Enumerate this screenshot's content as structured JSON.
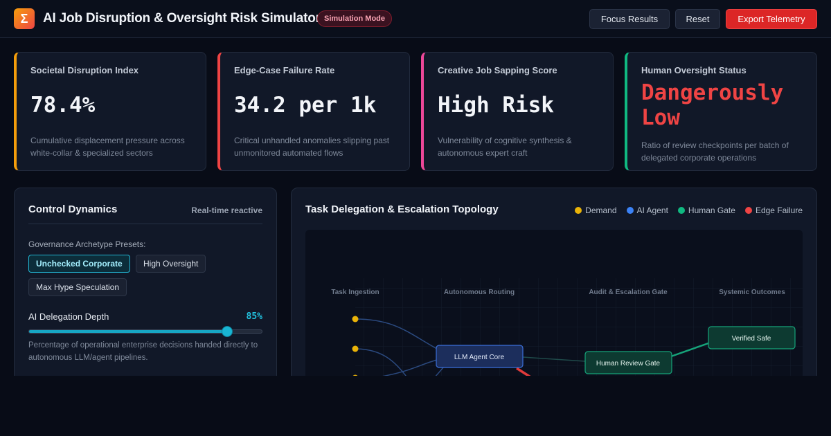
{
  "header": {
    "logo_glyph": "Σ",
    "title": "AI Job Disruption & Oversight Risk Simulator",
    "mode_badge": "Simulation Mode",
    "buttons": {
      "focus": "Focus Results",
      "reset": "Reset",
      "export": "Export Telemetry"
    }
  },
  "metrics": [
    {
      "title": "Societal Disruption Index",
      "value": "78.4%",
      "desc": "Cumulative displacement pressure across white-collar & specialized sectors",
      "accent": "#f59e0b"
    },
    {
      "title": "Edge-Case Failure Rate",
      "value": "34.2 per 1k",
      "desc": "Critical unhandled anomalies slipping past unmonitored automated flows",
      "accent": "#ef4444"
    },
    {
      "title": "Creative Job Sapping Score",
      "value": "High Risk",
      "desc": "Vulnerability of cognitive synthesis & autonomous expert craft",
      "accent": "#ec4899"
    },
    {
      "title": "Human Oversight Status",
      "value": "Dangerously Low",
      "desc": "Ratio of review checkpoints per batch of delegated corporate operations",
      "accent": "#10b981",
      "value_color": "#ef4444"
    }
  ],
  "controls": {
    "title": "Control Dynamics",
    "tag": "Real-time reactive",
    "presets_label": "Governance Archetype Presets:",
    "presets": [
      "Unchecked Corporate",
      "High Oversight",
      "Max Hype Speculation"
    ],
    "active_preset": 0,
    "slider": {
      "label": "AI Delegation Depth",
      "value": 85,
      "value_text": "85%",
      "desc": "Percentage of operational enterprise decisions handed directly to autonomous LLM/agent pipelines."
    }
  },
  "topology": {
    "title": "Task Delegation & Escalation Topology",
    "legend": [
      {
        "label": "Demand",
        "color": "#eab308"
      },
      {
        "label": "AI Agent",
        "color": "#3b82f6"
      },
      {
        "label": "Human Gate",
        "color": "#10b981"
      },
      {
        "label": "Edge Failure",
        "color": "#ef4444"
      }
    ],
    "columns": [
      "Task Ingestion",
      "Autonomous Routing",
      "Audit & Escalation Gate",
      "Systemic Outcomes"
    ],
    "nodes": {
      "agent": "LLM Agent Core",
      "gate": "Human Review Gate",
      "safe": "Verified Safe"
    }
  }
}
